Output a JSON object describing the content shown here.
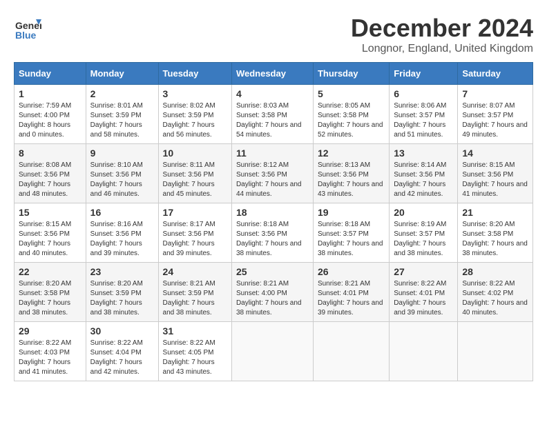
{
  "header": {
    "logo_general": "General",
    "logo_blue": "Blue",
    "title": "December 2024",
    "subtitle": "Longnor, England, United Kingdom"
  },
  "days_of_week": [
    "Sunday",
    "Monday",
    "Tuesday",
    "Wednesday",
    "Thursday",
    "Friday",
    "Saturday"
  ],
  "weeks": [
    [
      {
        "day": "1",
        "sunrise": "Sunrise: 7:59 AM",
        "sunset": "Sunset: 4:00 PM",
        "daylight": "Daylight: 8 hours and 0 minutes."
      },
      {
        "day": "2",
        "sunrise": "Sunrise: 8:01 AM",
        "sunset": "Sunset: 3:59 PM",
        "daylight": "Daylight: 7 hours and 58 minutes."
      },
      {
        "day": "3",
        "sunrise": "Sunrise: 8:02 AM",
        "sunset": "Sunset: 3:59 PM",
        "daylight": "Daylight: 7 hours and 56 minutes."
      },
      {
        "day": "4",
        "sunrise": "Sunrise: 8:03 AM",
        "sunset": "Sunset: 3:58 PM",
        "daylight": "Daylight: 7 hours and 54 minutes."
      },
      {
        "day": "5",
        "sunrise": "Sunrise: 8:05 AM",
        "sunset": "Sunset: 3:58 PM",
        "daylight": "Daylight: 7 hours and 52 minutes."
      },
      {
        "day": "6",
        "sunrise": "Sunrise: 8:06 AM",
        "sunset": "Sunset: 3:57 PM",
        "daylight": "Daylight: 7 hours and 51 minutes."
      },
      {
        "day": "7",
        "sunrise": "Sunrise: 8:07 AM",
        "sunset": "Sunset: 3:57 PM",
        "daylight": "Daylight: 7 hours and 49 minutes."
      }
    ],
    [
      {
        "day": "8",
        "sunrise": "Sunrise: 8:08 AM",
        "sunset": "Sunset: 3:56 PM",
        "daylight": "Daylight: 7 hours and 48 minutes."
      },
      {
        "day": "9",
        "sunrise": "Sunrise: 8:10 AM",
        "sunset": "Sunset: 3:56 PM",
        "daylight": "Daylight: 7 hours and 46 minutes."
      },
      {
        "day": "10",
        "sunrise": "Sunrise: 8:11 AM",
        "sunset": "Sunset: 3:56 PM",
        "daylight": "Daylight: 7 hours and 45 minutes."
      },
      {
        "day": "11",
        "sunrise": "Sunrise: 8:12 AM",
        "sunset": "Sunset: 3:56 PM",
        "daylight": "Daylight: 7 hours and 44 minutes."
      },
      {
        "day": "12",
        "sunrise": "Sunrise: 8:13 AM",
        "sunset": "Sunset: 3:56 PM",
        "daylight": "Daylight: 7 hours and 43 minutes."
      },
      {
        "day": "13",
        "sunrise": "Sunrise: 8:14 AM",
        "sunset": "Sunset: 3:56 PM",
        "daylight": "Daylight: 7 hours and 42 minutes."
      },
      {
        "day": "14",
        "sunrise": "Sunrise: 8:15 AM",
        "sunset": "Sunset: 3:56 PM",
        "daylight": "Daylight: 7 hours and 41 minutes."
      }
    ],
    [
      {
        "day": "15",
        "sunrise": "Sunrise: 8:15 AM",
        "sunset": "Sunset: 3:56 PM",
        "daylight": "Daylight: 7 hours and 40 minutes."
      },
      {
        "day": "16",
        "sunrise": "Sunrise: 8:16 AM",
        "sunset": "Sunset: 3:56 PM",
        "daylight": "Daylight: 7 hours and 39 minutes."
      },
      {
        "day": "17",
        "sunrise": "Sunrise: 8:17 AM",
        "sunset": "Sunset: 3:56 PM",
        "daylight": "Daylight: 7 hours and 39 minutes."
      },
      {
        "day": "18",
        "sunrise": "Sunrise: 8:18 AM",
        "sunset": "Sunset: 3:56 PM",
        "daylight": "Daylight: 7 hours and 38 minutes."
      },
      {
        "day": "19",
        "sunrise": "Sunrise: 8:18 AM",
        "sunset": "Sunset: 3:57 PM",
        "daylight": "Daylight: 7 hours and 38 minutes."
      },
      {
        "day": "20",
        "sunrise": "Sunrise: 8:19 AM",
        "sunset": "Sunset: 3:57 PM",
        "daylight": "Daylight: 7 hours and 38 minutes."
      },
      {
        "day": "21",
        "sunrise": "Sunrise: 8:20 AM",
        "sunset": "Sunset: 3:58 PM",
        "daylight": "Daylight: 7 hours and 38 minutes."
      }
    ],
    [
      {
        "day": "22",
        "sunrise": "Sunrise: 8:20 AM",
        "sunset": "Sunset: 3:58 PM",
        "daylight": "Daylight: 7 hours and 38 minutes."
      },
      {
        "day": "23",
        "sunrise": "Sunrise: 8:20 AM",
        "sunset": "Sunset: 3:59 PM",
        "daylight": "Daylight: 7 hours and 38 minutes."
      },
      {
        "day": "24",
        "sunrise": "Sunrise: 8:21 AM",
        "sunset": "Sunset: 3:59 PM",
        "daylight": "Daylight: 7 hours and 38 minutes."
      },
      {
        "day": "25",
        "sunrise": "Sunrise: 8:21 AM",
        "sunset": "Sunset: 4:00 PM",
        "daylight": "Daylight: 7 hours and 38 minutes."
      },
      {
        "day": "26",
        "sunrise": "Sunrise: 8:21 AM",
        "sunset": "Sunset: 4:01 PM",
        "daylight": "Daylight: 7 hours and 39 minutes."
      },
      {
        "day": "27",
        "sunrise": "Sunrise: 8:22 AM",
        "sunset": "Sunset: 4:01 PM",
        "daylight": "Daylight: 7 hours and 39 minutes."
      },
      {
        "day": "28",
        "sunrise": "Sunrise: 8:22 AM",
        "sunset": "Sunset: 4:02 PM",
        "daylight": "Daylight: 7 hours and 40 minutes."
      }
    ],
    [
      {
        "day": "29",
        "sunrise": "Sunrise: 8:22 AM",
        "sunset": "Sunset: 4:03 PM",
        "daylight": "Daylight: 7 hours and 41 minutes."
      },
      {
        "day": "30",
        "sunrise": "Sunrise: 8:22 AM",
        "sunset": "Sunset: 4:04 PM",
        "daylight": "Daylight: 7 hours and 42 minutes."
      },
      {
        "day": "31",
        "sunrise": "Sunrise: 8:22 AM",
        "sunset": "Sunset: 4:05 PM",
        "daylight": "Daylight: 7 hours and 43 minutes."
      },
      null,
      null,
      null,
      null
    ]
  ]
}
